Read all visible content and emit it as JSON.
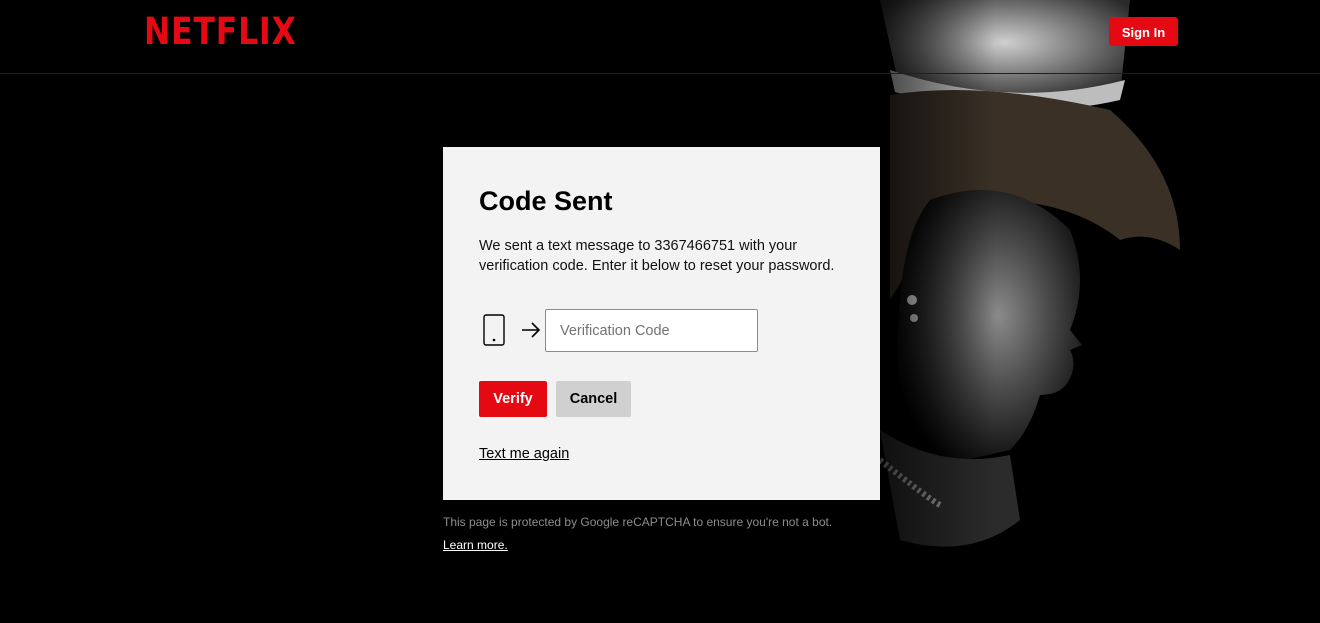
{
  "header": {
    "logo_text": "NETFLIX",
    "signin_label": "Sign In"
  },
  "card": {
    "title": "Code Sent",
    "description": "We sent a text message to 3367466751 with your verification code. Enter it below to reset your password.",
    "code_input": {
      "value": "",
      "placeholder": "Verification Code"
    },
    "verify_label": "Verify",
    "cancel_label": "Cancel",
    "resend_label": "Text me again"
  },
  "footer": {
    "recaptcha_text": "This page is protected by Google reCAPTCHA to ensure you're not a bot.",
    "learn_more_label": "Learn more."
  },
  "icons": {
    "phone": "phone-icon",
    "arrow": "arrow-right-icon"
  },
  "colors": {
    "brand": "#e50914",
    "background": "#000000",
    "card": "#f3f3f3",
    "cancel": "#d0d0d0",
    "muted_text": "#8c8c8c"
  }
}
